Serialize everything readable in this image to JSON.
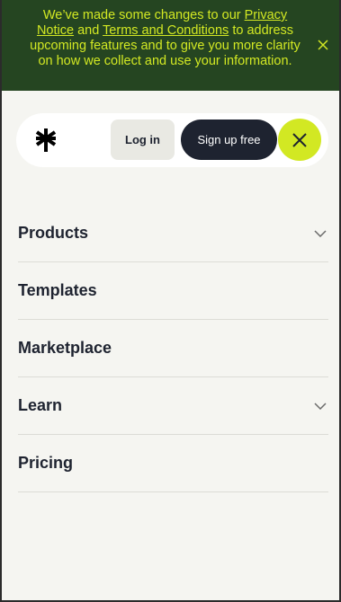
{
  "banner": {
    "text_1": "We’ve made some changes to our ",
    "privacy_link": "Privacy Notice",
    "text_2": " and ",
    "terms_link": "Terms and Conditions",
    "text_3": " to address upcoming features and to give you more clarity on how we collect and use your information.",
    "close_icon": "close-icon"
  },
  "header": {
    "logo_icon": "asterisk-logo-icon",
    "login_label": "Log in",
    "signup_label": "Sign up free",
    "close_icon": "close-icon"
  },
  "nav": {
    "items": [
      {
        "label": "Products",
        "has_chevron": true
      },
      {
        "label": "Templates",
        "has_chevron": false
      },
      {
        "label": "Marketplace",
        "has_chevron": false
      },
      {
        "label": "Learn",
        "has_chevron": true
      },
      {
        "label": "Pricing",
        "has_chevron": false
      }
    ]
  },
  "colors": {
    "banner_bg": "#254521",
    "banner_text": "#d2e823",
    "accent": "#d2e823",
    "dark": "#1e2330",
    "page_bg": "#f5f5f1"
  }
}
